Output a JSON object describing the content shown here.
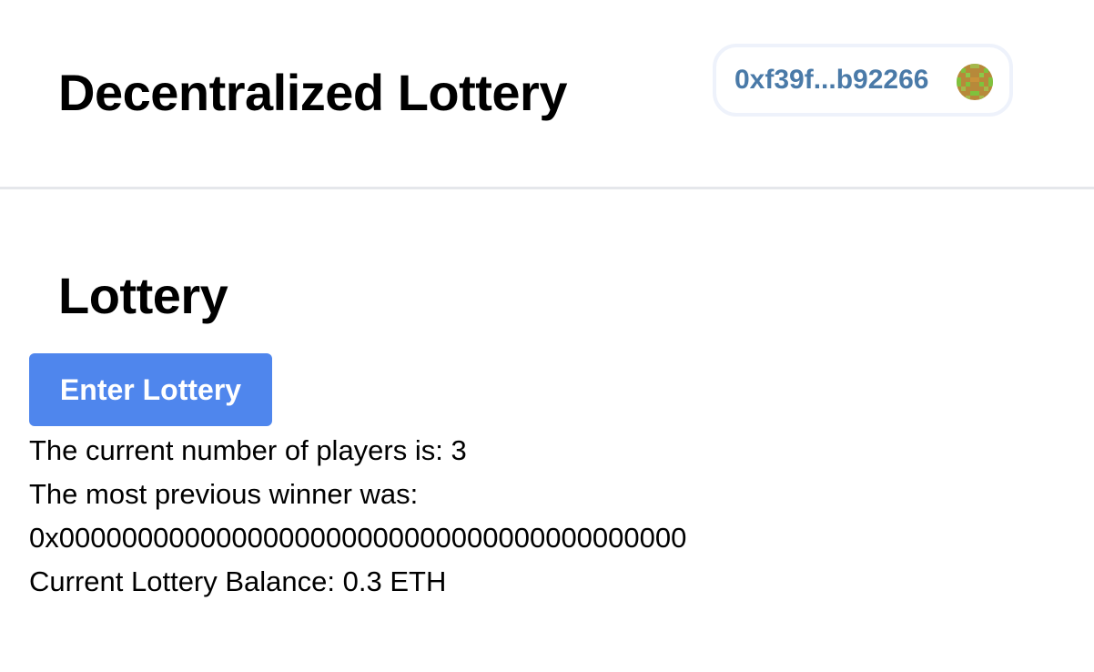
{
  "header": {
    "title": "Decentralized Lottery",
    "account": {
      "address": "0xf39f...b92266",
      "address_color": "#4a7aa8",
      "avatar_icon": "identicon-avatar"
    }
  },
  "main": {
    "title": "Lottery",
    "enter_button_label": "Enter Lottery",
    "accent_color": "#4f86ed",
    "players_text": "The current number of players is: 3",
    "winner_label": "The most previous winner was:",
    "winner_address": "0x0000000000000000000000000000000000000000",
    "balance_text": "Current Lottery Balance: 0.3 ETH"
  }
}
